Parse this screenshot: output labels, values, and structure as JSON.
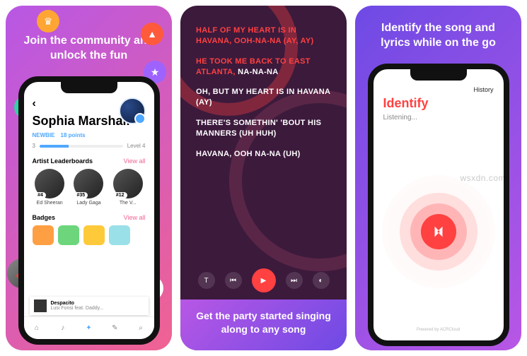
{
  "panel1": {
    "headline": "Join the community and unlock the fun",
    "profile": {
      "name": "Sophia Marshall",
      "status_label": "NEWBIE",
      "points": "18 points",
      "level_current": "3",
      "level_next": "Level 4"
    },
    "leaderboards": {
      "title": "Artist Leaderboards",
      "view_all": "View all",
      "artists": [
        {
          "rank": "#4",
          "name": "Ed Sheeran"
        },
        {
          "rank": "#35",
          "name": "Lady Gaga"
        },
        {
          "rank": "#12",
          "name": "The V..."
        }
      ]
    },
    "badges": {
      "title": "Badges",
      "view_all": "View all"
    },
    "now_playing": {
      "title": "Despacito",
      "subtitle": "Lusi Fonsi feat. Daddy..."
    }
  },
  "panel2": {
    "lyrics": [
      "HALF OF MY HEART IS IN HAVANA, OOH-NA-NA (AY, AY)",
      "HE TOOK ME BACK TO EAST ATLANTA, ",
      "NA-NA-NA",
      "OH, BUT MY HEART IS IN HAVANA (AY)",
      "THERE'S SOMETHIN' 'BOUT HIS MANNERS (UH HUH)",
      "HAVANA, OOH NA-NA (UH)"
    ],
    "caption": "Get the party started singing along to any song"
  },
  "panel3": {
    "headline": "Identify the song and lyrics while on the go",
    "history": "History",
    "title": "Identify",
    "listening": "Listening...",
    "powered": "Powered by ACRCloud"
  },
  "watermark": "wsxdn.com"
}
